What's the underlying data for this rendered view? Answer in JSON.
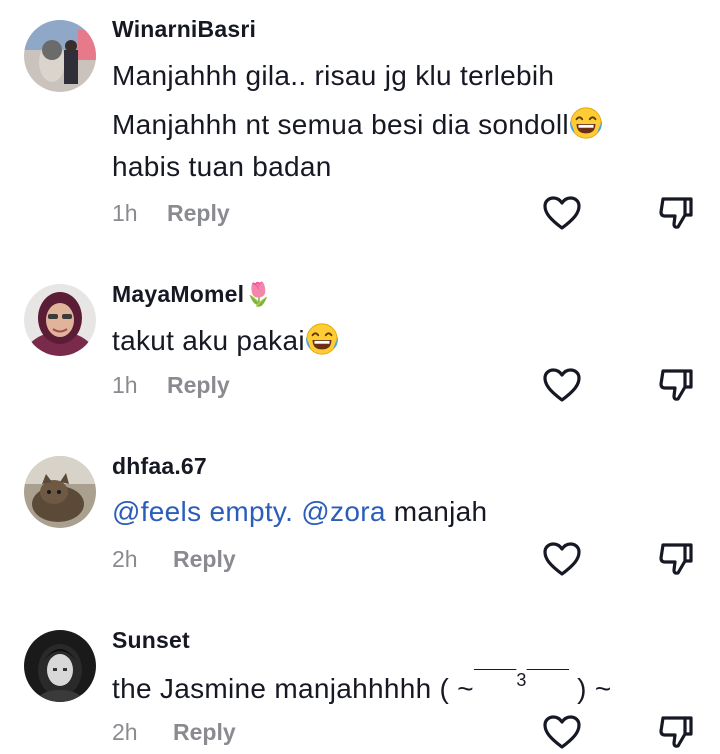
{
  "comments": [
    {
      "username": "WinarniBasri",
      "username_emoji": "",
      "lines": [
        "Manjahhh gila.. risau jg klu terlebih",
        "Manjahhh nt semua besi dia sondoll",
        "habis tuan badan"
      ],
      "time": "1h",
      "reply_label": "Reply"
    },
    {
      "username": "MayaMomel",
      "username_emoji": "🌷",
      "lines": [
        "takut aku pakai"
      ],
      "time": "1h",
      "reply_label": "Reply"
    },
    {
      "username": "dhfaa.67",
      "username_emoji": "",
      "mention1": "@feels empty.",
      "mention2": "@zora",
      "text_after": "manjah",
      "time": "2h",
      "reply_label": "Reply"
    },
    {
      "username": "Sunset",
      "username_emoji": "",
      "text_before": "the Jasmine manjahhhhh ( ~",
      "kaomoji_mid": "3",
      "text_after": ") ~",
      "time": "2h",
      "reply_label": "Reply"
    }
  ],
  "icons": {
    "like": "heart-outline-icon",
    "dislike": "thumbs-down-outline-icon",
    "laugh": "tears-of-joy-emoji"
  },
  "colors": {
    "mention": "#2b5db9",
    "meta": "#8a8b91",
    "text": "#161823"
  }
}
